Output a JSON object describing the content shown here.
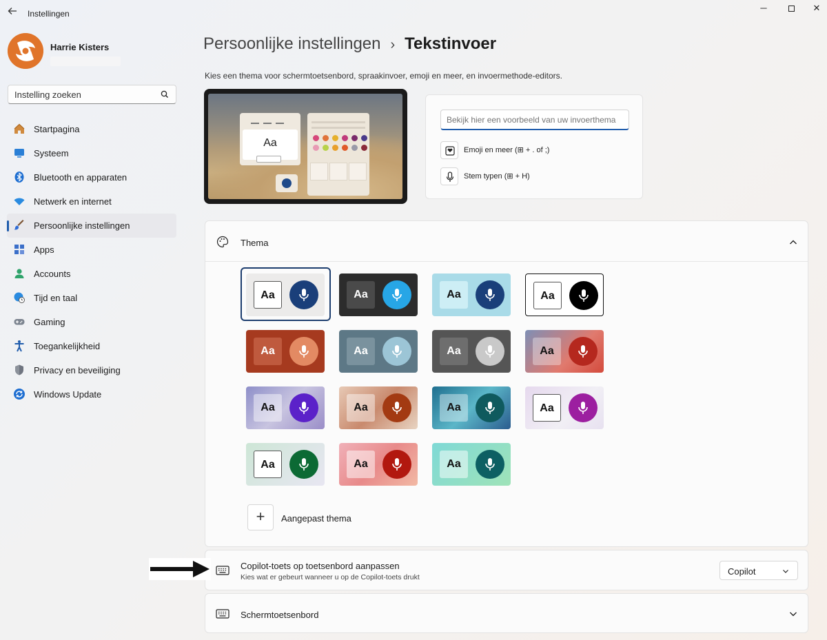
{
  "window": {
    "title": "Instellingen",
    "back_icon": "back-arrow-icon",
    "minimize": "─",
    "close": "✕"
  },
  "user": {
    "name": "Harrie Kisters"
  },
  "search": {
    "placeholder": "Instelling zoeken"
  },
  "sidebar": {
    "items": [
      {
        "label": "Startpagina",
        "icon": "home-icon"
      },
      {
        "label": "Systeem",
        "icon": "system-icon"
      },
      {
        "label": "Bluetooth en apparaten",
        "icon": "bluetooth-icon"
      },
      {
        "label": "Netwerk en internet",
        "icon": "wifi-icon"
      },
      {
        "label": "Persoonlijke instellingen",
        "icon": "brush-icon",
        "active": true
      },
      {
        "label": "Apps",
        "icon": "apps-icon"
      },
      {
        "label": "Accounts",
        "icon": "accounts-icon"
      },
      {
        "label": "Tijd en taal",
        "icon": "globe-clock-icon"
      },
      {
        "label": "Gaming",
        "icon": "gamepad-icon"
      },
      {
        "label": "Toegankelijkheid",
        "icon": "accessibility-icon"
      },
      {
        "label": "Privacy en beveiliging",
        "icon": "shield-icon"
      },
      {
        "label": "Windows Update",
        "icon": "update-icon"
      }
    ]
  },
  "header": {
    "parent": "Persoonlijke instellingen",
    "separator": "›",
    "current": "Tekstinvoer",
    "description": "Kies een thema voor schermtoetsenbord, spraakinvoer, emoji en meer, en invoermethode-editors."
  },
  "preview": {
    "keyboard_sample": "Aa",
    "input_placeholder": "Bekijk hier een voorbeeld van uw invoerthema",
    "emoji_label": "Emoji en meer (⊞ + . of ;)",
    "voice_label": "Stem typen (⊞ + H)"
  },
  "theme": {
    "title": "Thema",
    "sample_text": "Aa",
    "selected_index": 0,
    "tiles": [
      {
        "bg": "#ecebea",
        "aa_bg": "#ffffff",
        "aa_fg": "#111111",
        "mic": "#1a3f7a"
      },
      {
        "bg": "#2c2c2c",
        "aa_bg": "#4a4a4a",
        "aa_fg": "#ffffff",
        "mic": "#27a6e6"
      },
      {
        "bg": "#a9dbe8",
        "aa_bg": "#cdeef5",
        "aa_fg": "#111111",
        "mic": "#1a3f7a"
      },
      {
        "bg": "#ffffff",
        "aa_bg": "#ffffff",
        "aa_fg": "#111111",
        "mic": "#000000",
        "outlined": true
      },
      {
        "bg": "#a63a1f",
        "aa_bg": "#bf5a3e",
        "aa_fg": "#ffffff",
        "mic": "#e38a63"
      },
      {
        "bg": "#5d7886",
        "aa_bg": "#7a929e",
        "aa_fg": "#ffffff",
        "mic": "#9cc5d6"
      },
      {
        "bg": "#555555",
        "aa_bg": "#6e6e6e",
        "aa_fg": "#ffffff",
        "mic": "#c9c9c9"
      },
      {
        "bg": "linear-gradient(135deg,#7e8fb5,#e07a6e 60%,#d44a3c)",
        "aa_bg": "rgba(255,255,255,0.35)",
        "aa_fg": "#111111",
        "mic": "#b5281e"
      },
      {
        "bg": "linear-gradient(135deg,#8e8fc9,#c8c4e0 50%,#9a8dc8)",
        "aa_bg": "rgba(255,255,255,0.45)",
        "aa_fg": "#111111",
        "mic": "#5b21c9"
      },
      {
        "bg": "linear-gradient(135deg,#e7c9b5,#c98a6e 50%,#e8d4c2)",
        "aa_bg": "rgba(255,255,255,0.45)",
        "aa_fg": "#111111",
        "mic": "#a33a12"
      },
      {
        "bg": "linear-gradient(135deg,#1f6f8f,#5bb6c8 50%,#2a5c8e)",
        "aa_bg": "rgba(255,255,255,0.40)",
        "aa_fg": "#111111",
        "mic": "#0f5a5e"
      },
      {
        "bg": "linear-gradient(135deg,#e6d9ee,#f1eff5 60%,#e7e1f0)",
        "aa_bg": "#ffffff",
        "aa_fg": "#111111",
        "mic": "#9c1fa0"
      },
      {
        "bg": "linear-gradient(135deg,#cde6d6,#e8e6f2)",
        "aa_bg": "#ffffff",
        "aa_fg": "#111111",
        "mic": "#0c6a34"
      },
      {
        "bg": "linear-gradient(135deg,#f0b0b8,#e88a8a 50%,#f2b9a4)",
        "aa_bg": "rgba(255,255,255,0.50)",
        "aa_fg": "#111111",
        "mic": "#b2180f"
      },
      {
        "bg": "linear-gradient(135deg,#7fd9d6,#9fe3b8)",
        "aa_bg": "rgba(255,255,255,0.50)",
        "aa_fg": "#111111",
        "mic": "#0d5f63"
      }
    ],
    "custom_label": "Aangepast thema"
  },
  "copilot": {
    "title": "Copilot-toets op toetsenbord aanpassen",
    "subtitle": "Kies wat er gebeurt wanneer u op de Copilot-toets drukt",
    "dropdown_value": "Copilot"
  },
  "keyboard": {
    "title": "Schermtoetsenbord"
  },
  "colors": {
    "accent": "#1f5cac",
    "selected_ring": "#1c3d6e"
  }
}
